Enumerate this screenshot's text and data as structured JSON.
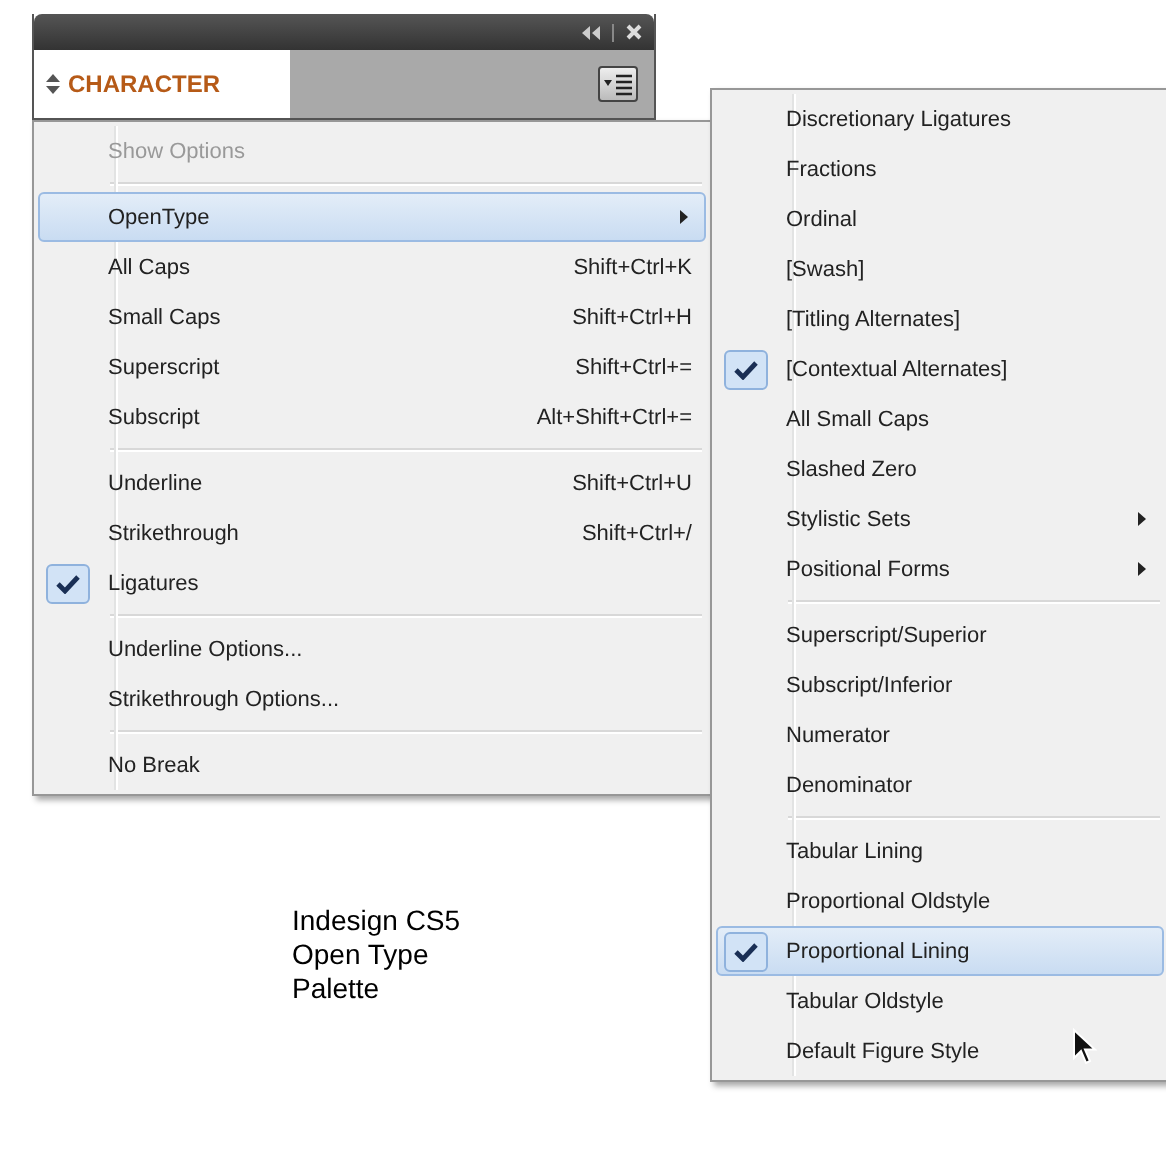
{
  "panel": {
    "title": "CHARACTER"
  },
  "menu": {
    "items": [
      {
        "kind": "item",
        "label": "Show Options",
        "disabled": true,
        "checked": false,
        "selected": false,
        "submenu": false
      },
      {
        "kind": "separator"
      },
      {
        "kind": "item",
        "label": "OpenType",
        "disabled": false,
        "checked": false,
        "selected": true,
        "submenu": true
      },
      {
        "kind": "item",
        "label": "All Caps",
        "shortcut": "Shift+Ctrl+K",
        "disabled": false,
        "checked": false,
        "selected": false,
        "submenu": false
      },
      {
        "kind": "item",
        "label": "Small Caps",
        "shortcut": "Shift+Ctrl+H",
        "disabled": false,
        "checked": false,
        "selected": false,
        "submenu": false
      },
      {
        "kind": "item",
        "label": "Superscript",
        "shortcut": "Shift+Ctrl+=",
        "disabled": false,
        "checked": false,
        "selected": false,
        "submenu": false
      },
      {
        "kind": "item",
        "label": "Subscript",
        "shortcut": "Alt+Shift+Ctrl+=",
        "disabled": false,
        "checked": false,
        "selected": false,
        "submenu": false
      },
      {
        "kind": "separator"
      },
      {
        "kind": "item",
        "label": "Underline",
        "shortcut": "Shift+Ctrl+U",
        "disabled": false,
        "checked": false,
        "selected": false,
        "submenu": false
      },
      {
        "kind": "item",
        "label": "Strikethrough",
        "shortcut": "Shift+Ctrl+/",
        "disabled": false,
        "checked": false,
        "selected": false,
        "submenu": false
      },
      {
        "kind": "item",
        "label": "Ligatures",
        "disabled": false,
        "checked": true,
        "selected": false,
        "submenu": false
      },
      {
        "kind": "separator"
      },
      {
        "kind": "item",
        "label": "Underline Options...",
        "disabled": false,
        "checked": false,
        "selected": false,
        "submenu": false
      },
      {
        "kind": "item",
        "label": "Strikethrough Options...",
        "disabled": false,
        "checked": false,
        "selected": false,
        "submenu": false
      },
      {
        "kind": "separator"
      },
      {
        "kind": "item",
        "label": "No Break",
        "disabled": false,
        "checked": false,
        "selected": false,
        "submenu": false
      }
    ]
  },
  "submenu": {
    "items": [
      {
        "kind": "item",
        "label": "Discretionary Ligatures",
        "disabled": false,
        "checked": false,
        "selected": false,
        "submenu": false
      },
      {
        "kind": "item",
        "label": "Fractions",
        "disabled": false,
        "checked": false,
        "selected": false,
        "submenu": false
      },
      {
        "kind": "item",
        "label": "Ordinal",
        "disabled": false,
        "checked": false,
        "selected": false,
        "submenu": false
      },
      {
        "kind": "item",
        "label": "[Swash]",
        "disabled": false,
        "checked": false,
        "selected": false,
        "submenu": false
      },
      {
        "kind": "item",
        "label": "[Titling Alternates]",
        "disabled": false,
        "checked": false,
        "selected": false,
        "submenu": false
      },
      {
        "kind": "item",
        "label": "[Contextual Alternates]",
        "disabled": false,
        "checked": true,
        "selected": false,
        "submenu": false
      },
      {
        "kind": "item",
        "label": "All Small Caps",
        "disabled": false,
        "checked": false,
        "selected": false,
        "submenu": false
      },
      {
        "kind": "item",
        "label": "Slashed Zero",
        "disabled": false,
        "checked": false,
        "selected": false,
        "submenu": false
      },
      {
        "kind": "item",
        "label": "Stylistic Sets",
        "disabled": false,
        "checked": false,
        "selected": false,
        "submenu": true
      },
      {
        "kind": "item",
        "label": "Positional Forms",
        "disabled": false,
        "checked": false,
        "selected": false,
        "submenu": true
      },
      {
        "kind": "separator"
      },
      {
        "kind": "item",
        "label": "Superscript/Superior",
        "disabled": false,
        "checked": false,
        "selected": false,
        "submenu": false
      },
      {
        "kind": "item",
        "label": "Subscript/Inferior",
        "disabled": false,
        "checked": false,
        "selected": false,
        "submenu": false
      },
      {
        "kind": "item",
        "label": "Numerator",
        "disabled": false,
        "checked": false,
        "selected": false,
        "submenu": false
      },
      {
        "kind": "item",
        "label": "Denominator",
        "disabled": false,
        "checked": false,
        "selected": false,
        "submenu": false
      },
      {
        "kind": "separator"
      },
      {
        "kind": "item",
        "label": "Tabular Lining",
        "disabled": false,
        "checked": false,
        "selected": false,
        "submenu": false
      },
      {
        "kind": "item",
        "label": "Proportional Oldstyle",
        "disabled": false,
        "checked": false,
        "selected": false,
        "submenu": false
      },
      {
        "kind": "item",
        "label": "Proportional Lining",
        "disabled": false,
        "checked": true,
        "selected": true,
        "submenu": false
      },
      {
        "kind": "item",
        "label": "Tabular Oldstyle",
        "disabled": false,
        "checked": false,
        "selected": false,
        "submenu": false
      },
      {
        "kind": "item",
        "label": "Default Figure Style",
        "disabled": false,
        "checked": false,
        "selected": false,
        "submenu": false
      }
    ]
  },
  "caption": {
    "lines": [
      "Indesign CS5",
      "Open Type",
      "Palette"
    ]
  }
}
